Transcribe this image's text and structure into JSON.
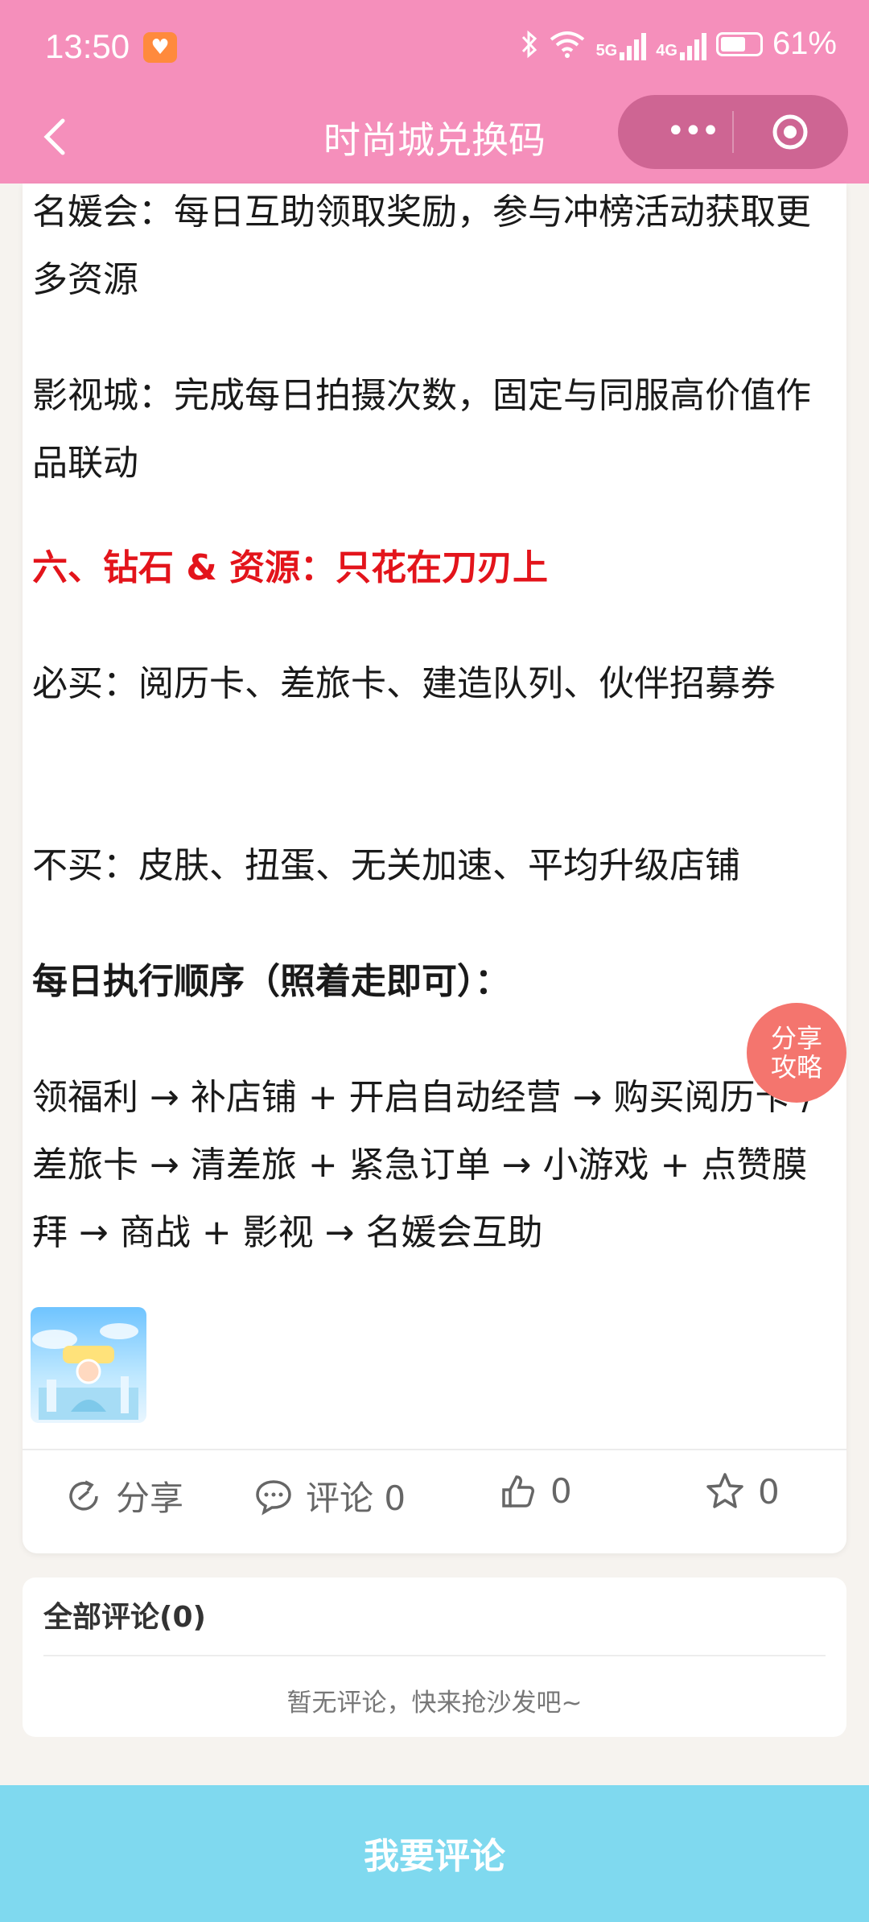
{
  "status_bar": {
    "time": "13:50",
    "battery": "61%",
    "net1": "5G",
    "net2": "4G",
    "wifi_gen": "6"
  },
  "nav": {
    "title": "时尚城兑换码"
  },
  "article": {
    "p1": "名媛会：每日互助领取奖励，参与冲榜活动获取更多资源",
    "p2": "影视城：完成每日拍摄次数，固定与同服高价值作品联动",
    "h6": "六、钻石 & 资源：只花在刀刃上",
    "p3": "必买：阅历卡、差旅卡、建造队列、伙伴招募券",
    "p4": "不买：皮肤、扭蛋、无关加速、平均升级店铺",
    "h_daily": "每日执行顺序（照着走即可）：",
    "p5": "领福利 → 补店铺 + 开启自动经营 → 购买阅历卡 / 差旅卡 → 清差旅 + 紧急订单 → 小游戏 + 点赞膜拜 → 商战 + 影视 → 名媛会互助"
  },
  "actions": {
    "share": "分享",
    "comment": "评论 0",
    "like": "0",
    "favorite": "0"
  },
  "fab": {
    "line1": "分享",
    "line2": "攻略"
  },
  "comments": {
    "title": "全部评论(0)",
    "empty": "暂无评论，快来抢沙发吧~"
  },
  "bottom_button": "我要评论",
  "colors": {
    "header": "#f58fbb",
    "accent_red": "#e3141b",
    "bottom": "#7fd9ef",
    "fab": "#f4756e"
  }
}
